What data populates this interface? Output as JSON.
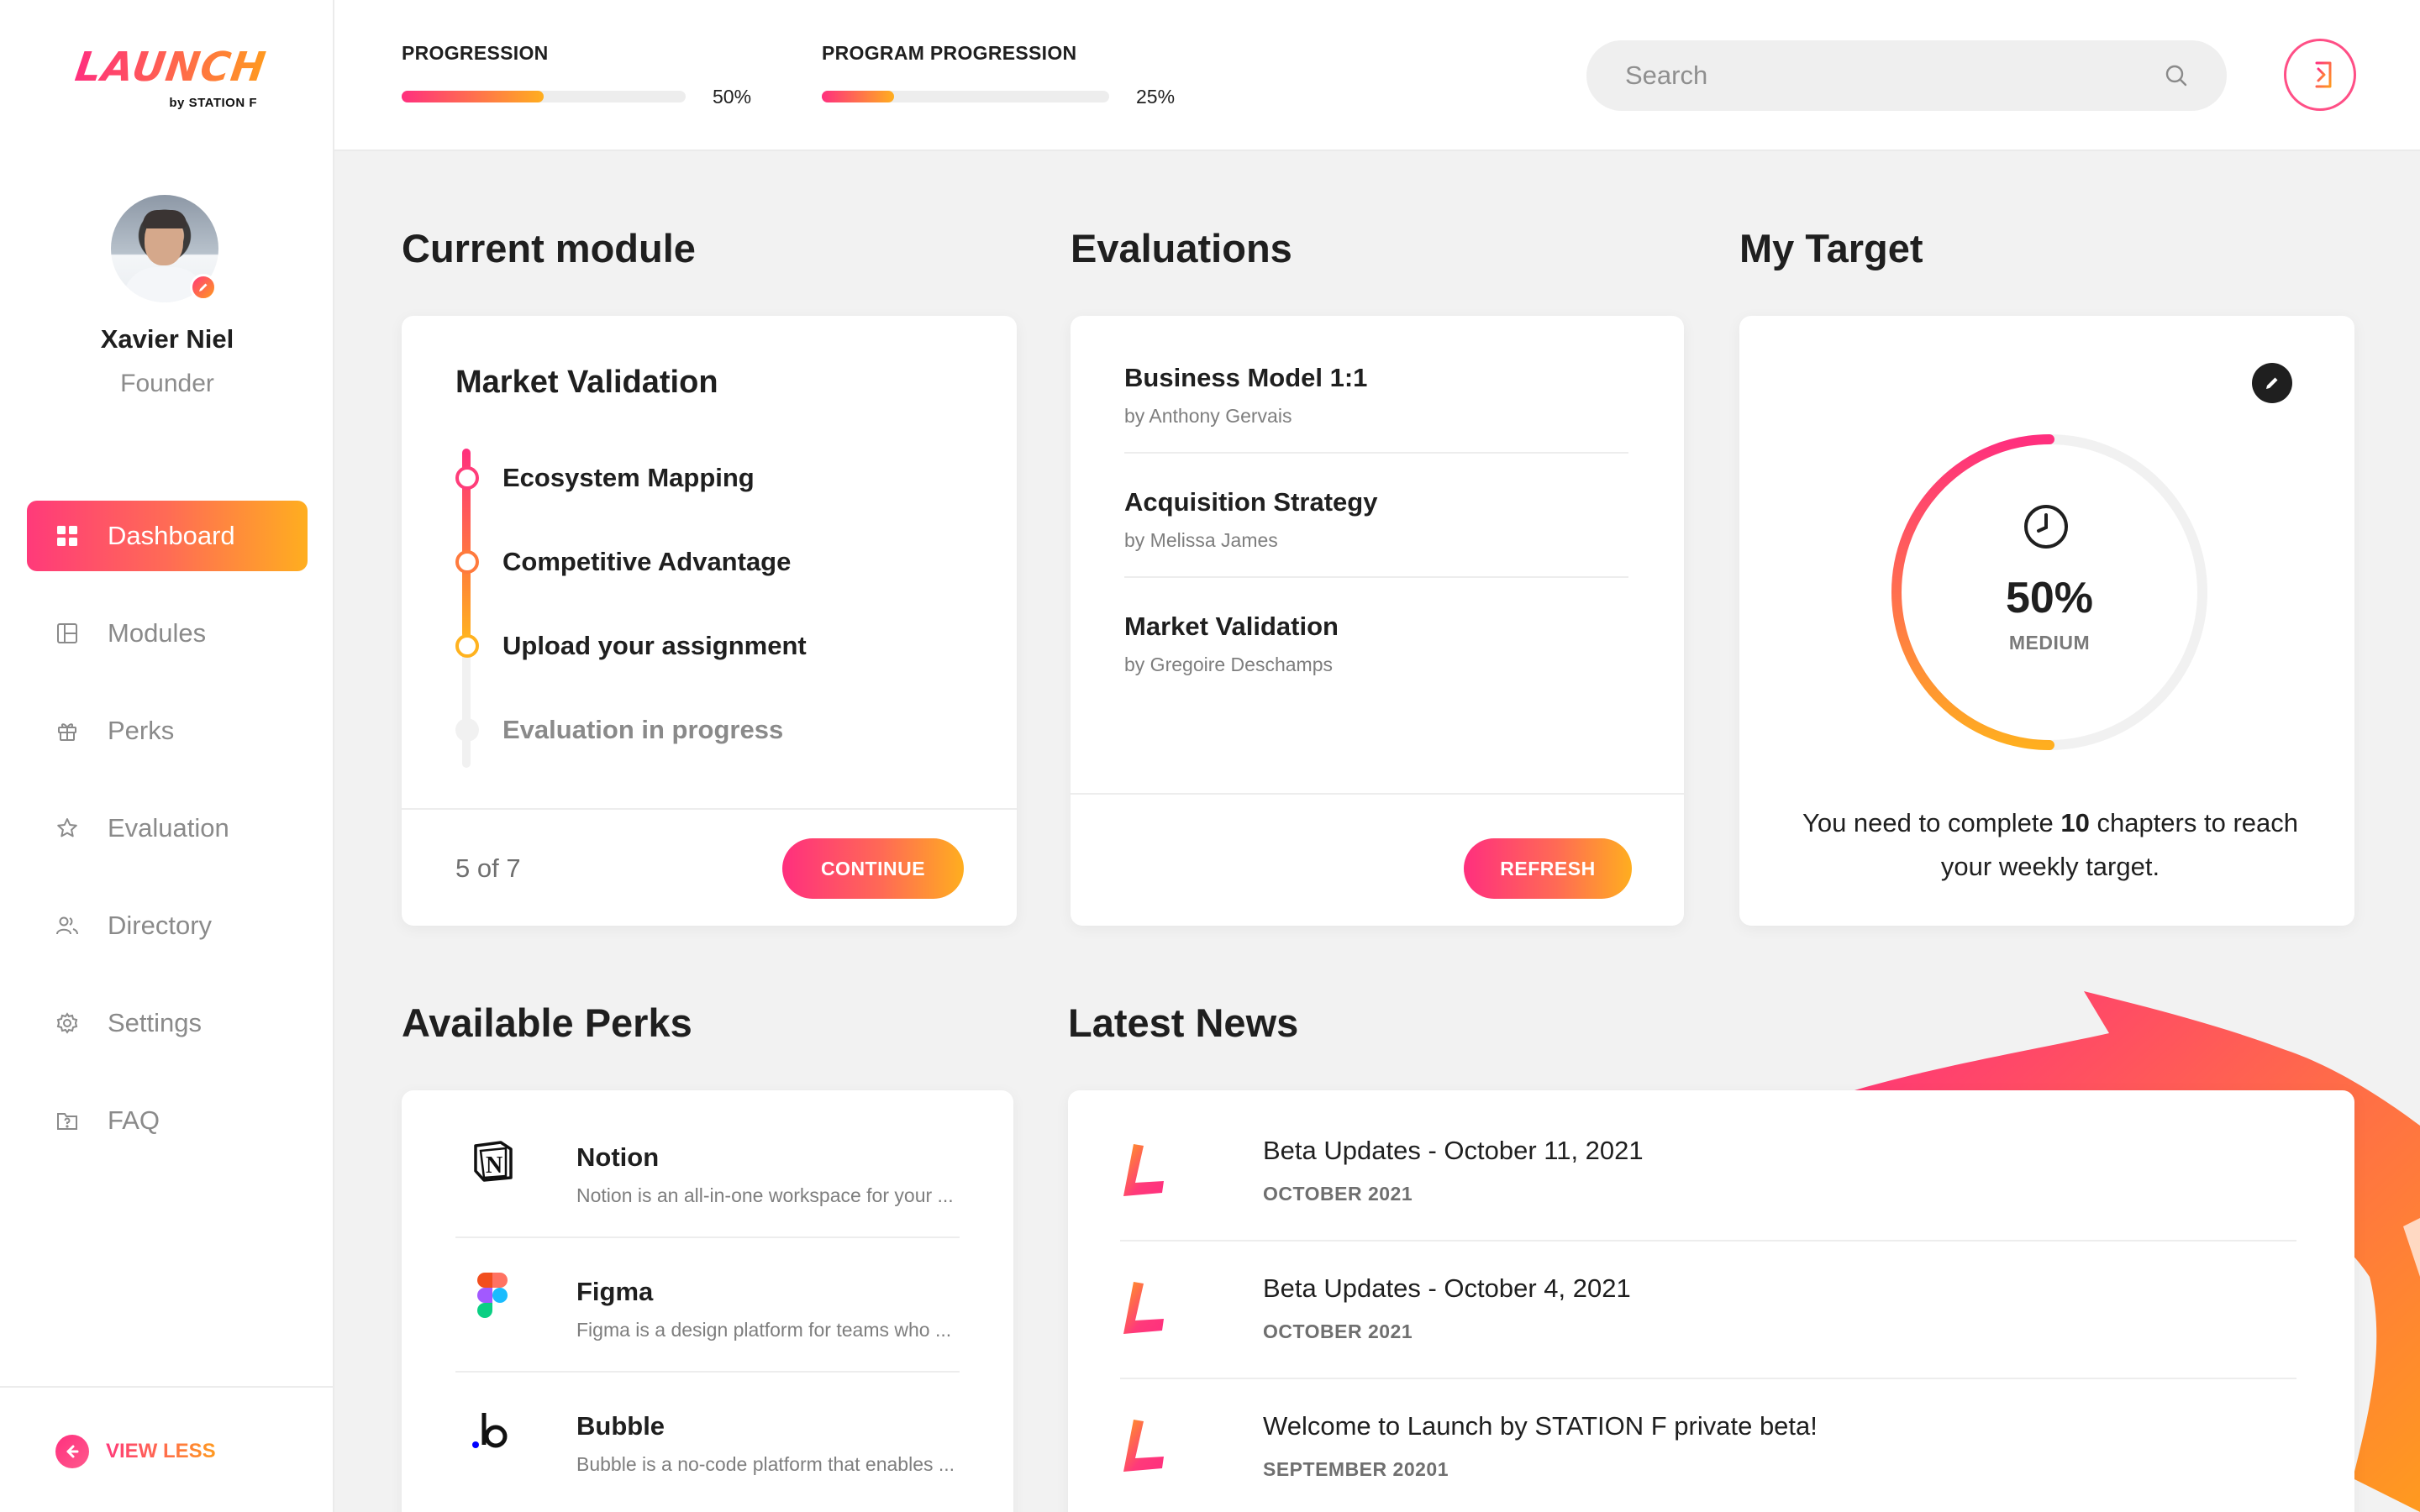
{
  "brand": {
    "logo_text": "LAUNCH",
    "logo_sub": "by STATION F",
    "accent_start": "#ff2f7e",
    "accent_end": "#ffae1f"
  },
  "user": {
    "name": "Xavier Niel",
    "role": "Founder"
  },
  "sidebar": {
    "items": [
      {
        "label": "Dashboard",
        "icon": "grid-icon",
        "active": true
      },
      {
        "label": "Modules",
        "icon": "layout-icon",
        "active": false
      },
      {
        "label": "Perks",
        "icon": "gift-icon",
        "active": false
      },
      {
        "label": "Evaluation",
        "icon": "star-icon",
        "active": false
      },
      {
        "label": "Directory",
        "icon": "users-icon",
        "active": false
      },
      {
        "label": "Settings",
        "icon": "gear-icon",
        "active": false
      },
      {
        "label": "FAQ",
        "icon": "folder-question-icon",
        "active": false
      }
    ],
    "view_less": "VIEW LESS"
  },
  "topbar": {
    "progression": {
      "label": "PROGRESSION",
      "value_text": "50%",
      "value": 0.5
    },
    "program_progression": {
      "label": "PROGRAM PROGRESSION",
      "value_text": "25%",
      "value": 0.25
    },
    "search_placeholder": "Search"
  },
  "current_module": {
    "heading": "Current module",
    "title": "Market Validation",
    "steps": [
      {
        "label": "Ecosystem Mapping",
        "state": "done",
        "color": "#ff3d7a"
      },
      {
        "label": "Competitive Advantage",
        "state": "done",
        "color": "#ff7a3d"
      },
      {
        "label": "Upload your assignment",
        "state": "current",
        "color": "#ffb21f"
      },
      {
        "label": "Evaluation in progress",
        "state": "pending",
        "color": "#f1f1f1"
      }
    ],
    "count": "5 of 7",
    "continue_label": "CONTINUE"
  },
  "evaluations": {
    "heading": "Evaluations",
    "items": [
      {
        "title": "Business Model 1:1",
        "by": "by Anthony Gervais"
      },
      {
        "title": "Acquisition Strategy",
        "by": "by Melissa James"
      },
      {
        "title": "Market Validation",
        "by": "by Gregoire Deschamps"
      }
    ],
    "refresh_label": "REFRESH"
  },
  "target": {
    "heading": "My Target",
    "percent_text": "50%",
    "percent": 0.5,
    "level": "MEDIUM",
    "text_before": "You need to complete ",
    "chapters": "10",
    "text_after": " chapters to reach your weekly target."
  },
  "perks": {
    "heading": "Available Perks",
    "items": [
      {
        "name": "Notion",
        "desc": "Notion is an all-in-one workspace for your ...",
        "icon": "notion-icon"
      },
      {
        "name": "Figma",
        "desc": "Figma is a design platform for teams who ...",
        "icon": "figma-icon"
      },
      {
        "name": "Bubble",
        "desc": "Bubble is a no-code platform that enables ...",
        "icon": "bubble-icon"
      }
    ]
  },
  "news": {
    "heading": "Latest News",
    "items": [
      {
        "title": "Beta Updates - October 11, 2021",
        "date": "OCTOBER 2021"
      },
      {
        "title": "Beta Updates - October 4, 2021",
        "date": "OCTOBER 2021"
      },
      {
        "title": "Welcome to Launch by STATION F private beta!",
        "date": "SEPTEMBER 20201"
      }
    ]
  }
}
